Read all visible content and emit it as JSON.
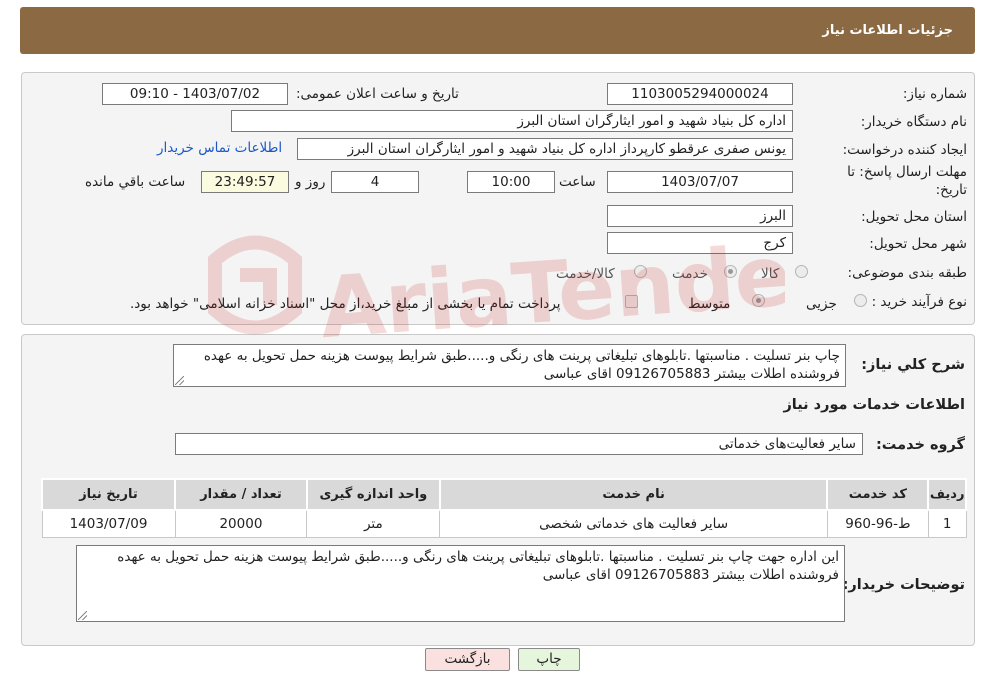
{
  "header": {
    "title": "جزئیات اطلاعات نیاز"
  },
  "info": {
    "need_number_label": "شماره نیاز:",
    "need_number": "1103005294000024",
    "announce_label": "تاریخ و ساعت اعلان عمومی:",
    "announce_value": "1403/07/02 - 09:10",
    "buyer_org_label": "نام دستگاه خریدار:",
    "buyer_org": "اداره کل بنیاد شهید و امور ایثارگران استان البرز",
    "creator_label": "ایجاد کننده درخواست:",
    "creator": "یونس  صفری عرقطو کارپرداز اداره کل بنیاد شهید و امور ایثارگران استان البرز",
    "contact_link": "اطلاعات تماس خریدار",
    "deadline_label_1": "مهلت ارسال پاسخ: تا",
    "deadline_label_2": "تاریخ:",
    "deadline_date": "1403/07/07",
    "time_label": "ساعت",
    "deadline_time": "10:00",
    "days_value": "4",
    "days_label": "روز و",
    "remaining_time": "23:49:57",
    "remaining_label": "ساعت باقي مانده",
    "province_label": "استان محل تحویل:",
    "province": "البرز",
    "city_label": "شهر محل تحویل:",
    "city": "کرج",
    "category_label": "طبقه بندی موضوعی:",
    "category_options": [
      "کالا",
      "خدمت",
      "کالا/خدمت"
    ],
    "process_label": "نوع فرآیند خرید :",
    "process_options": [
      "جزیی",
      "متوسط"
    ],
    "payment_note": "پرداخت تمام یا بخشی از مبلغ خرید،از محل \"اسناد خزانه اسلامی\" خواهد بود."
  },
  "details": {
    "summary_label": "شرح کلي نياز:",
    "summary_text": "چاپ بنر تسلیت . مناسبتها .تابلوهای تبلیغاتی  پرینت های رنگی و.....طبق شرایط پیوست هزینه حمل تحویل به عهده فروشنده اطلات بیشتر 09126705883 اقای عباسی",
    "services_title": "اطلاعات خدمات مورد نیاز",
    "group_label": "گروه خدمت:",
    "group_value": "سایر فعالیت‌های خدماتی",
    "table": {
      "headers": [
        "ردیف",
        "کد خدمت",
        "نام خدمت",
        "واحد اندازه گیری",
        "تعداد / مقدار",
        "تاریخ نیاز"
      ],
      "rows": [
        [
          "1",
          "ط-96-960",
          "سایر فعالیت های خدماتی شخصی",
          "متر",
          "20000",
          "1403/07/09"
        ]
      ]
    },
    "buyer_notes_label": "توضیحات خریدار:",
    "buyer_notes": "این اداره جهت چاپ بنر تسلیت . مناسبتها .تابلوهای تبلیغاتی  پرینت های رنگی و.....طبق شرایط پیوست هزینه حمل تحویل به عهده فروشنده اطلات بیشتر 09126705883 اقای عباسی"
  },
  "buttons": {
    "print": "چاپ",
    "back": "بازگشت"
  },
  "watermark": "AriaTender.neT",
  "colors": {
    "header": "#8b6a43",
    "link": "#1a57c9",
    "print_btn": "#e6f6dc",
    "back_btn": "#fbe0e0",
    "watermark": "#c81e1e"
  }
}
